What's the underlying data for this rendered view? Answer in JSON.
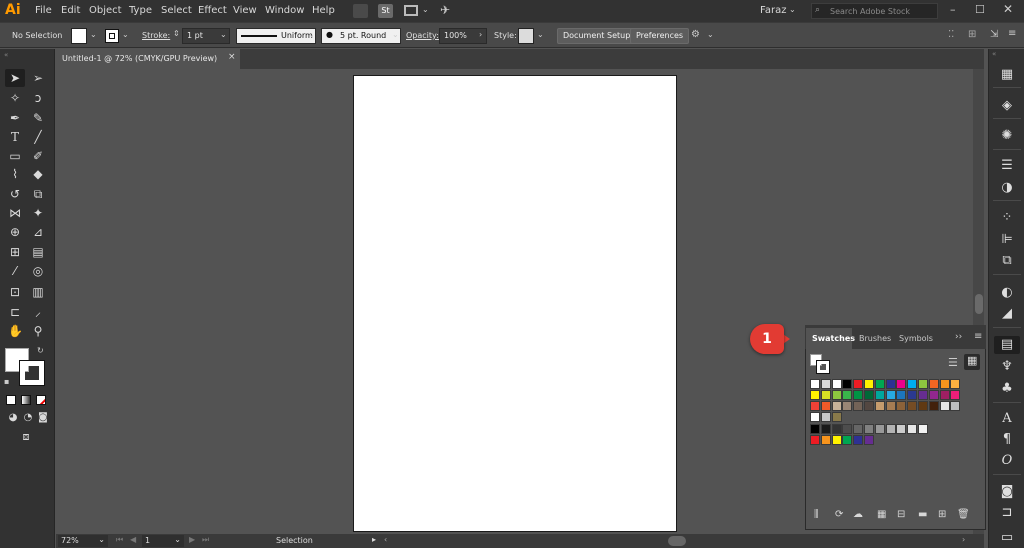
{
  "app": {
    "logo": "Ai"
  },
  "menu": [
    "File",
    "Edit",
    "Object",
    "Type",
    "Select",
    "Effect",
    "View",
    "Window",
    "Help"
  ],
  "user": {
    "name": "Faraz"
  },
  "search": {
    "placeholder": "Search Adobe Stock"
  },
  "control": {
    "selection": "No Selection",
    "stroke_label": "Stroke:",
    "stroke_value": "1 pt",
    "profile": "Uniform",
    "brush": "5 pt. Round",
    "opacity_label": "Opacity:",
    "opacity_value": "100%",
    "style_label": "Style:",
    "document_setup": "Document Setup",
    "preferences": "Preferences"
  },
  "document": {
    "tab_title": "Untitled-1 @ 72% (CMYK/GPU Preview)",
    "close": "×"
  },
  "status": {
    "zoom": "72%",
    "page": "1",
    "tool": "Selection"
  },
  "callout": {
    "number": "1"
  },
  "swatches_panel": {
    "tabs": [
      "Swatches",
      "Brushes",
      "Symbols"
    ],
    "more": "››",
    "menu": "≡",
    "rows": [
      [
        "#ffffff",
        "#d8d8d8",
        "#ffffff",
        "#000000",
        "#ed1c24",
        "#fff200",
        "#00a651",
        "#2e3192",
        "#ec008c",
        "#00aeef",
        "#8dc63f",
        "#f26522",
        "#f7941d",
        "#fbb040"
      ],
      [
        "#fff200",
        "#d7df23",
        "#8dc63f",
        "#39b54a",
        "#009444",
        "#006838",
        "#00a79d",
        "#27aae1",
        "#1c75bc",
        "#2b3990",
        "#662d91",
        "#92278f",
        "#9e1f63",
        "#ed1e79"
      ],
      [
        "#ef4136",
        "#f15a29",
        "#c7b299",
        "#998675",
        "#736357",
        "#534741",
        "#c69c6d",
        "#a67c52",
        "#8c6239",
        "#754c24",
        "#603913",
        "#42210b",
        "#e6e6e6",
        "#bcbec0"
      ],
      [
        "#ffffff",
        "#c8c8c8",
        "#8a7a4a"
      ],
      [
        "#000000",
        "#1a1a1a",
        "#333333",
        "#4d4d4d",
        "#666666",
        "#808080",
        "#999999",
        "#b3b3b3",
        "#cccccc",
        "#e6e6e6",
        "#f2f2f2"
      ],
      [
        "#ed1c24",
        "#f7941d",
        "#fff200",
        "#00a651",
        "#2e3192",
        "#662d91"
      ]
    ]
  },
  "colors": {
    "artboard": "#ffffff",
    "callout": "#e23b33",
    "logo": "#ff9a00"
  }
}
